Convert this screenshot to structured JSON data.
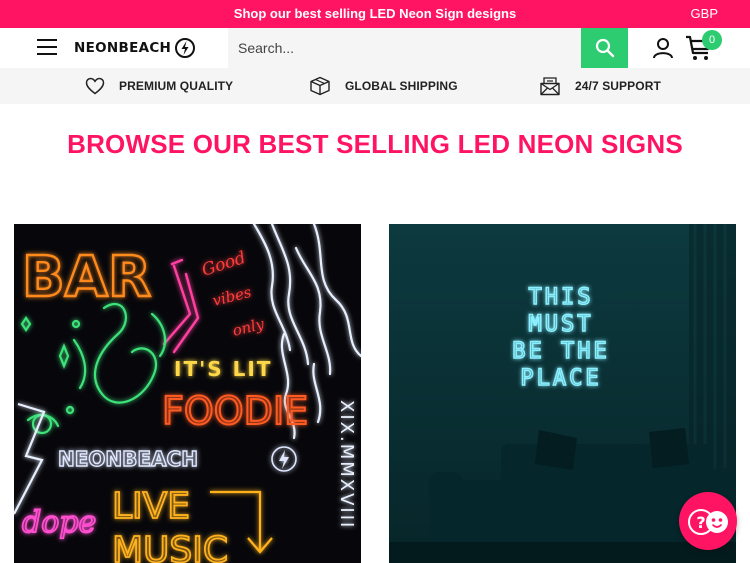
{
  "announcement": {
    "text": "Shop our best selling LED Neon Sign designs",
    "currency": "GBP"
  },
  "header": {
    "logo_text": "NEONBEACH",
    "search_placeholder": "Search...",
    "cart_count": "0",
    "icons": {
      "menu": "hamburger-menu-icon",
      "search": "search-icon",
      "account": "user-icon",
      "cart": "cart-icon"
    }
  },
  "features": [
    {
      "label": "PREMIUM QUALITY",
      "icon": "heart-icon"
    },
    {
      "label": "GLOBAL SHIPPING",
      "icon": "box-icon"
    },
    {
      "label": "24/7 SUPPORT",
      "icon": "mail-icon"
    }
  ],
  "section": {
    "heading": "BROWSE OUR BEST SELLING LED NEON SIGNS"
  },
  "products": [
    {
      "image_signs": [
        "BAR",
        "Good",
        "vibes",
        "only",
        "IT'S LIT",
        "FOODIE",
        "NEONBEACH",
        "dope",
        "LIVE",
        "MUSIC",
        "XIX.MMXVIII"
      ]
    },
    {
      "image_sign_lines": [
        "THIS",
        "MUST",
        "BE THE",
        "PLACE"
      ]
    }
  ],
  "colors": {
    "brand_pink": "#ff1464",
    "accent_green": "#2ecc71",
    "neon_orange": "#ff7a1a",
    "neon_cyan": "#7fe9ff"
  }
}
